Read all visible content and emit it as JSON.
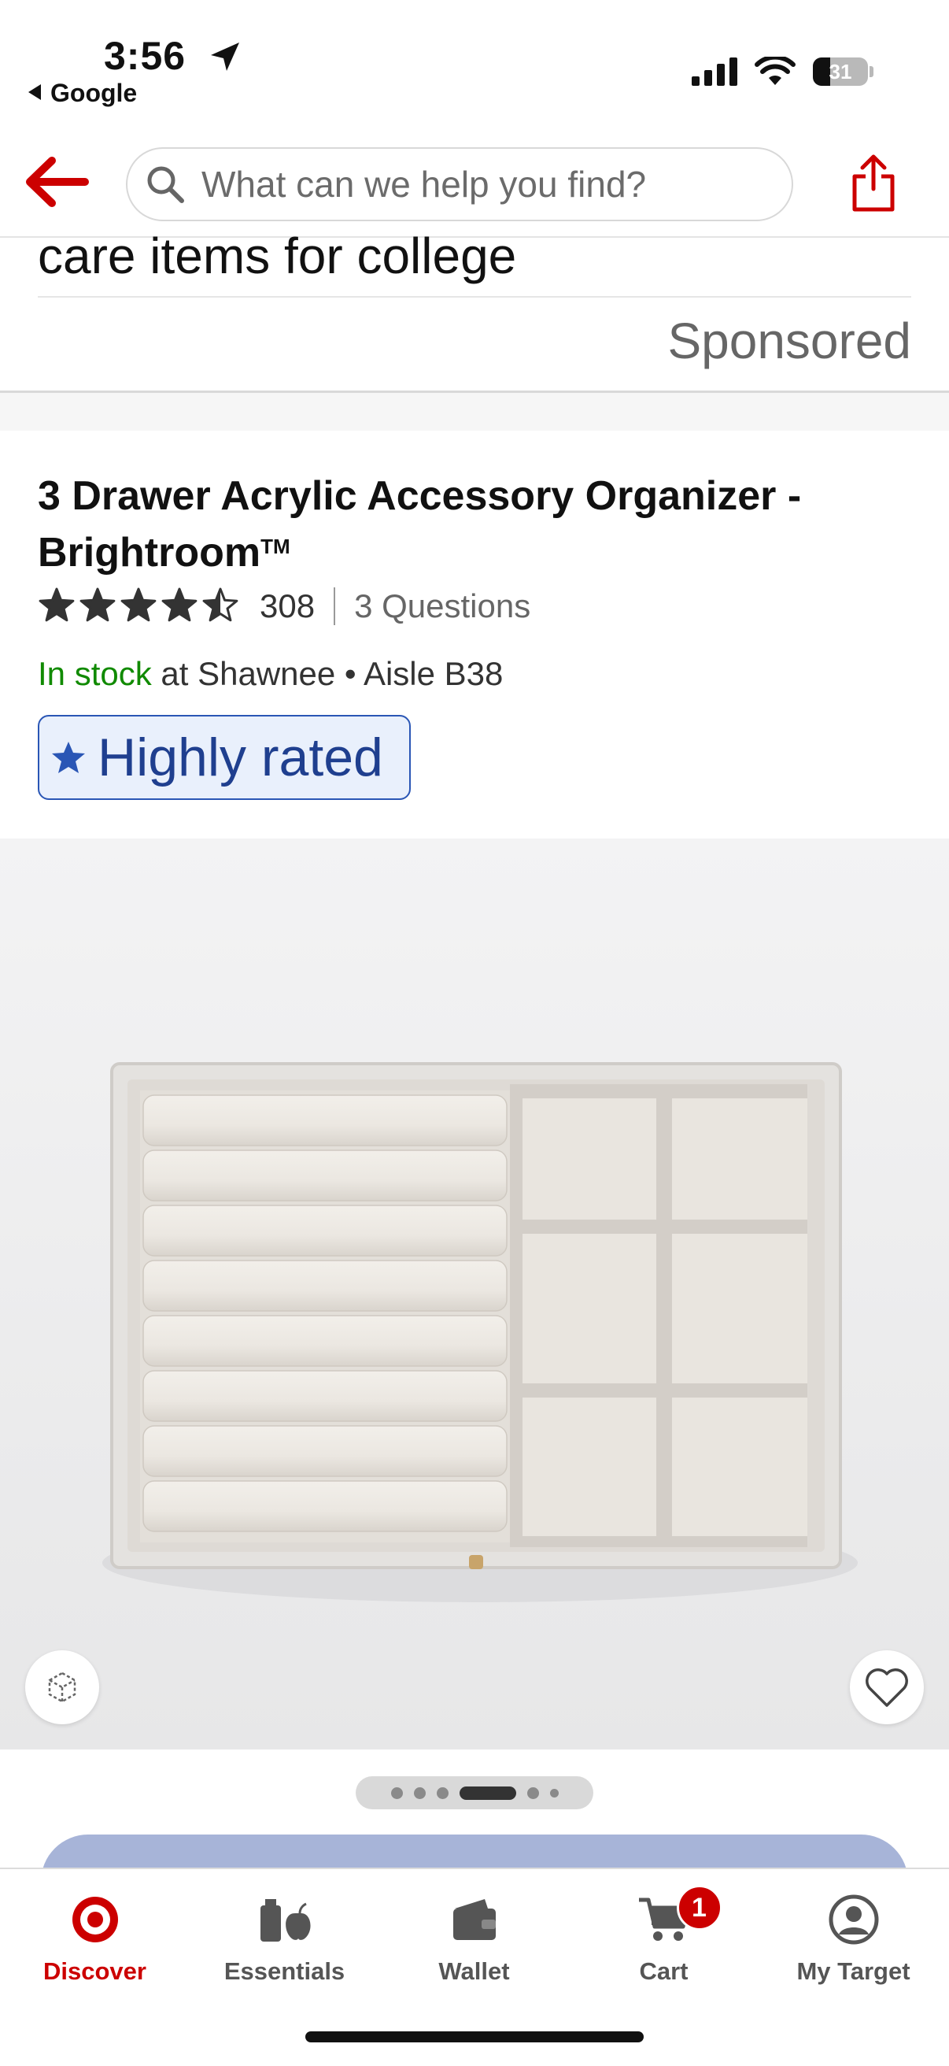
{
  "status_bar": {
    "time": "3:56",
    "back_app": "Google",
    "battery": "31"
  },
  "header": {
    "search_placeholder": "What can we help you find?"
  },
  "previous_section": {
    "title_partial": "care items for college",
    "sponsored_label": "Sponsored"
  },
  "product": {
    "title": "3 Drawer Acrylic Accessory Organizer - Brightroom",
    "trademark": "TM",
    "rating": 4.5,
    "review_count": "308",
    "questions": "3 Questions",
    "stock_status": "In stock",
    "stock_location": " at Shawnee • Aisle B38",
    "badge": "Highly rated",
    "image_carousel": {
      "count": 6,
      "active_index": 3
    }
  },
  "tabs": [
    {
      "id": "discover",
      "label": "Discover",
      "icon": "target-bullseye-icon",
      "active": true
    },
    {
      "id": "essentials",
      "label": "Essentials",
      "icon": "essentials-icon",
      "active": false
    },
    {
      "id": "wallet",
      "label": "Wallet",
      "icon": "wallet-icon",
      "active": false
    },
    {
      "id": "cart",
      "label": "Cart",
      "icon": "cart-icon",
      "active": false,
      "badge": "1"
    },
    {
      "id": "my_target",
      "label": "My Target",
      "icon": "account-icon",
      "active": false
    }
  ],
  "colors": {
    "brand_red": "#cc0000",
    "in_stock_green": "#108a00",
    "badge_blue": "#1f3f8f",
    "badge_bg": "#e9f0fc",
    "cta_blue": "#a7b4d8"
  }
}
